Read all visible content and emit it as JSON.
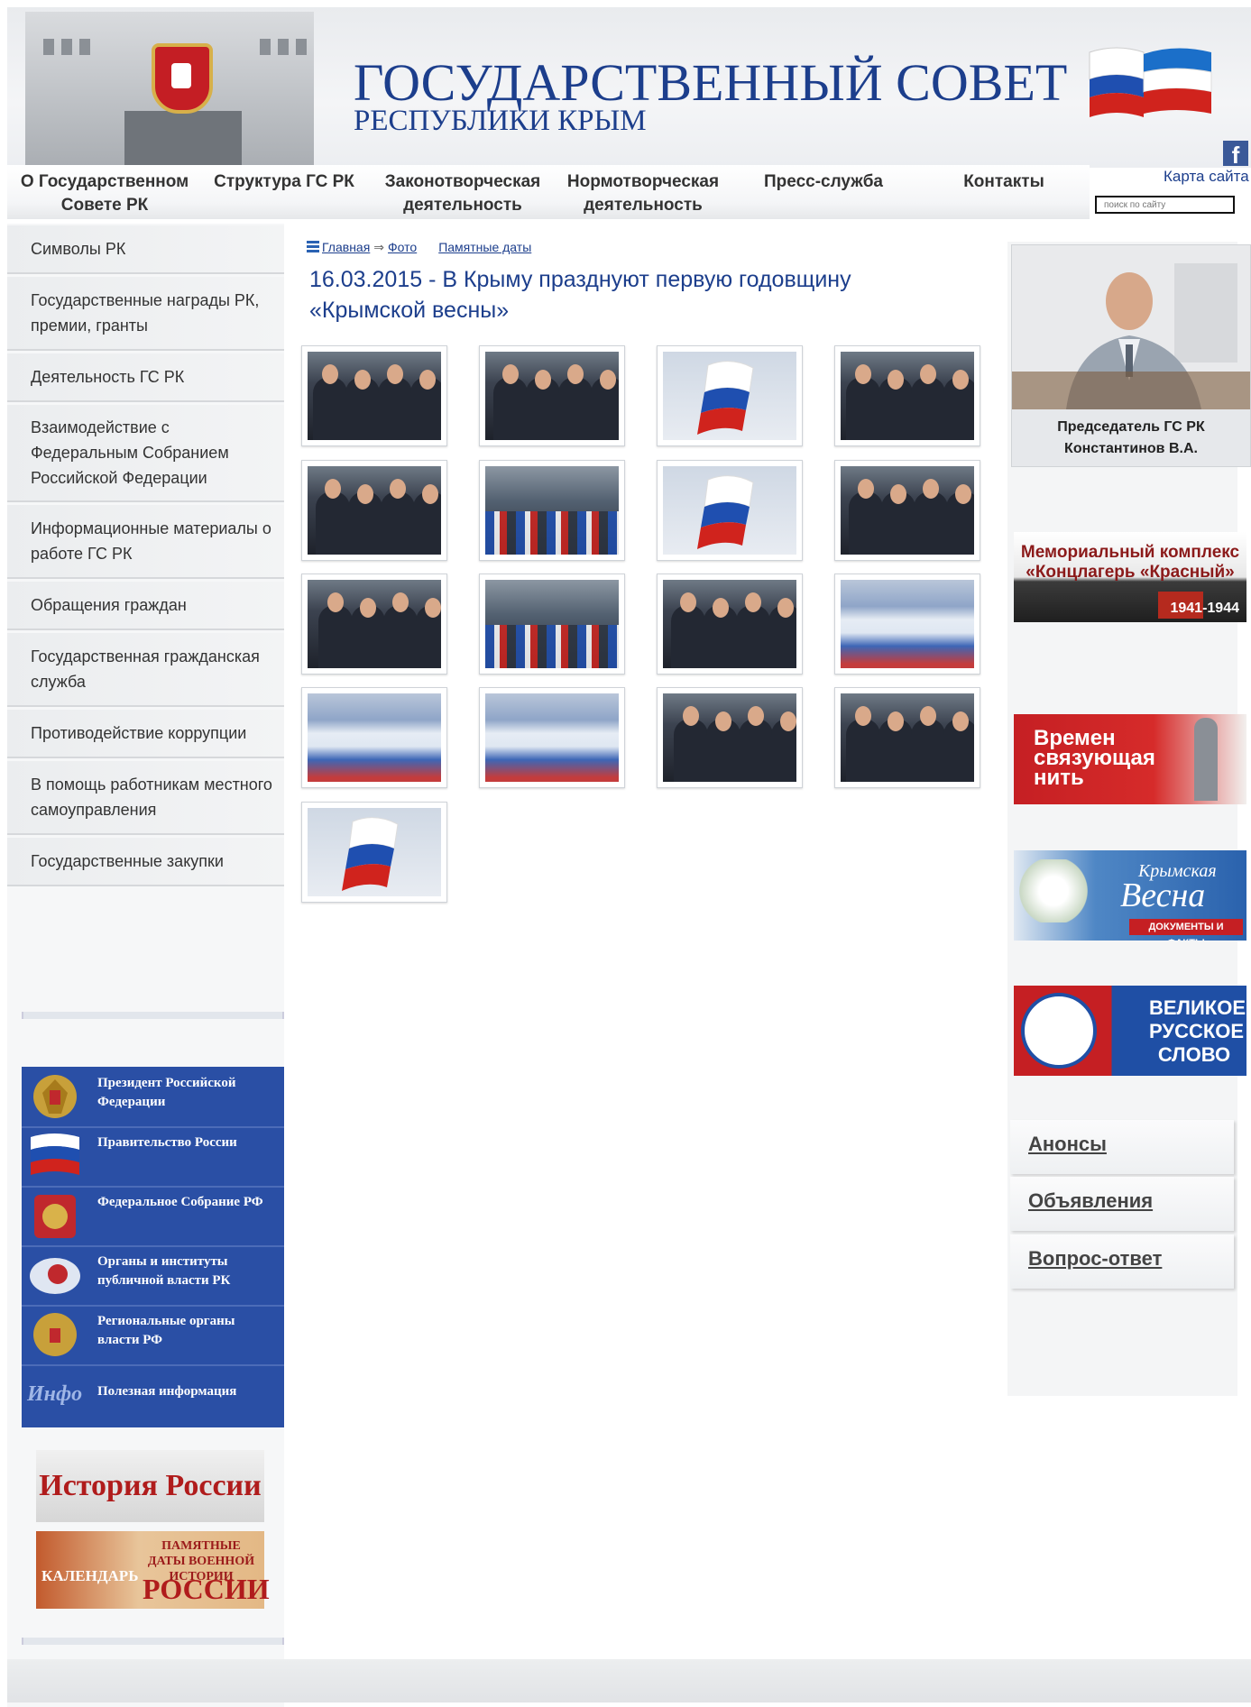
{
  "header": {
    "title_line1": "ГОСУДАРСТВЕННЫЙ СОВЕТ",
    "title_line2": "РЕСПУБЛИКИ КРЫМ",
    "facebook_label": "f"
  },
  "nav": {
    "items": [
      {
        "line1": "О Государственном",
        "line2": "Совете РК"
      },
      {
        "line1": "Структура ГС РК",
        "line2": ""
      },
      {
        "line1": "Законотворческая",
        "line2": "деятельность"
      },
      {
        "line1": "Нормотворческая",
        "line2": "деятельность"
      },
      {
        "line1": "Пресс-служба",
        "line2": ""
      },
      {
        "line1": "Контакты",
        "line2": ""
      }
    ],
    "sitemap_label": "Карта сайта",
    "search_placeholder": "поиск по сайту"
  },
  "sidebar": {
    "menu": [
      "Символы РК",
      "Государственные награды РК, премии, гранты",
      "Деятельность ГС РК",
      "Взаимодействие с Федеральным Собранием Российской Федерации",
      "Информационные материалы о работе ГС РК",
      "Обращения граждан",
      "Государственная гражданская служба",
      "Противодействие коррупции",
      "В помощь работникам местного самоуправления",
      "Государственные закупки"
    ],
    "links": [
      "Президент Российской Федерации",
      "Правительство России",
      "Федеральное Собрание РФ",
      "Органы и институты публичной власти РК",
      "Региональные органы власти РФ",
      "Полезная информация"
    ],
    "info_icon_text": "Инфо",
    "history_banner": "История России",
    "calendar_banner": {
      "left": "КАЛЕНДАРЬ",
      "top": "ПАМЯТНЫЕ ДАТЫ ВОЕННОЙ ИСТОРИИ",
      "bottom": "РОССИИ"
    }
  },
  "breadcrumb": {
    "home": "Главная",
    "photo": "Фото",
    "section": "Памятные даты"
  },
  "page_title": "16.03.2015 - В Крыму празднуют первую годовщину «Крымской весны»",
  "gallery": {
    "photos": [
      "people",
      "people",
      "flag",
      "people",
      "people",
      "crowd",
      "flag",
      "people",
      "people",
      "crowd",
      "people",
      "bigflag",
      "bigflag",
      "bigflag",
      "people",
      "people",
      "flag"
    ]
  },
  "right": {
    "chairman_caption_line1": "Председатель ГС РК",
    "chairman_caption_line2": "Константинов В.А.",
    "banners": [
      {
        "line1": "Мемориальный комплекс",
        "line2": "«Концлагерь «Красный»",
        "line3": "1941-1944"
      },
      {
        "line1": "Времен",
        "line2": "связующая",
        "line3": "нить"
      },
      {
        "line1": "Крымская",
        "line2": "Весна",
        "line3": "ДОКУМЕНТЫ И ФАКТЫ"
      },
      {
        "line1": "ВЕЛИКОЕ",
        "line2": "РУССКОЕ",
        "line3": "СЛОВО"
      }
    ],
    "tabs": [
      "Анонсы",
      "Объявления",
      "Вопрос-ответ"
    ]
  },
  "colors": {
    "brand_blue": "#1c3e8c",
    "links_blue": "#2a4fa5",
    "flag_white": "#ffffff",
    "flag_blue": "#1f4fb0",
    "flag_red": "#d0231d"
  }
}
